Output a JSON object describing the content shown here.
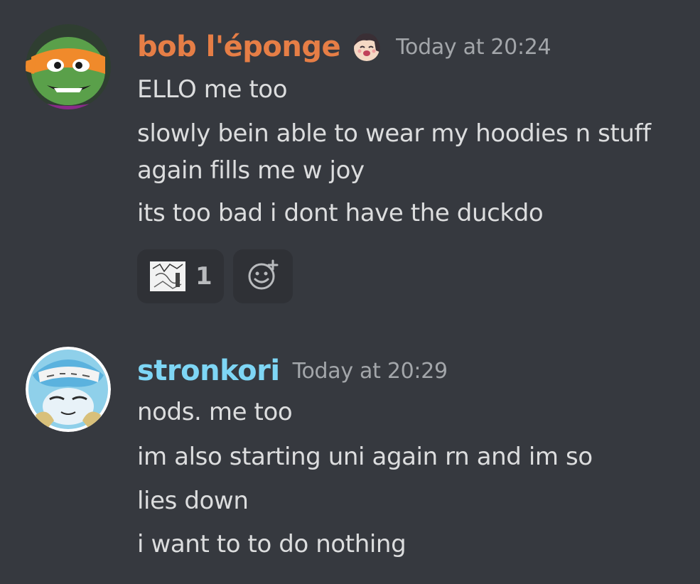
{
  "messages": [
    {
      "username": "bob l'éponge",
      "username_color": "#e67e46",
      "timestamp": "Today at 20:24",
      "avatar": "orange-masked-turtle-avatar",
      "has_role_icon": true,
      "lines": [
        "ELLO me too",
        "slowly bein able to wear my hoodies n stuff",
        "again fills me w joy",
        "its too bad i dont have the duckdo"
      ],
      "reactions": [
        {
          "emoji": "whiteboard-sketch-emoji",
          "count": "1"
        }
      ]
    },
    {
      "username": "stronkori",
      "username_color": "#7ed6f5",
      "timestamp": "Today at 20:29",
      "avatar": "blue-haired-character-avatar",
      "lines": [
        "nods. me too",
        "im also starting uni again rn and im so",
        "lies down",
        "i want to to do nothing"
      ]
    }
  ],
  "colors": {
    "background": "#36393f",
    "text": "#dcddde",
    "muted": "#a3a6aa",
    "reaction_bg": "#2f3136"
  },
  "icons": {
    "add_reaction": "add-reaction-smiley-icon"
  }
}
